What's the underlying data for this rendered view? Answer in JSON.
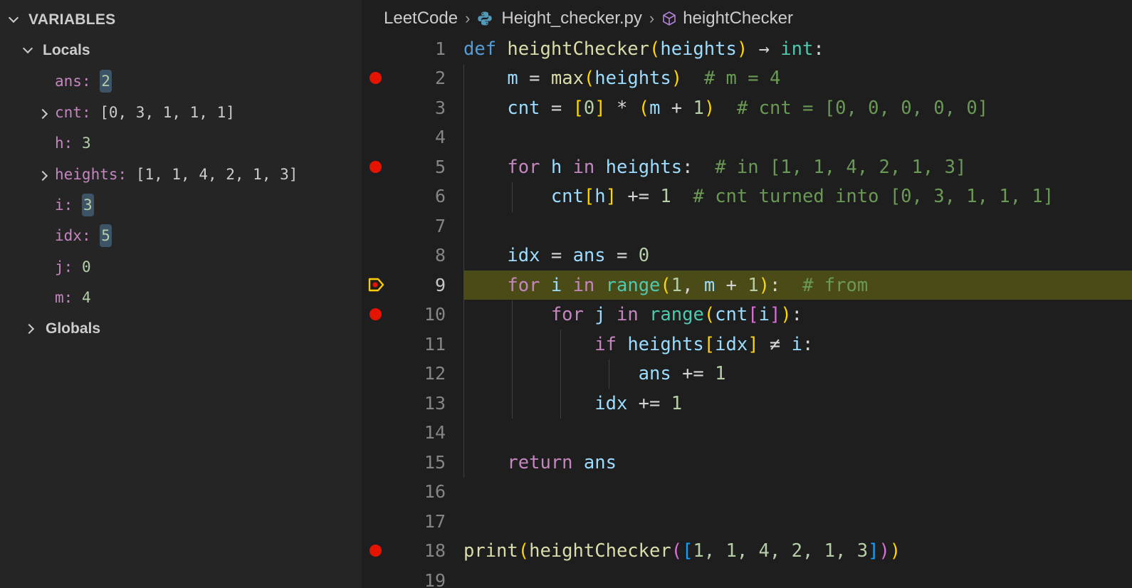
{
  "variables_panel": {
    "title": "VARIABLES",
    "locals_label": "Locals",
    "globals_label": "Globals",
    "locals": [
      {
        "name": "ans",
        "value": "2"
      },
      {
        "name": "cnt",
        "value": "[0, 3, 1, 1, 1]"
      },
      {
        "name": "h",
        "value": "3"
      },
      {
        "name": "heights",
        "value": "[1, 1, 4, 2, 1, 3]"
      },
      {
        "name": "i",
        "value": "3"
      },
      {
        "name": "idx",
        "value": "5"
      },
      {
        "name": "j",
        "value": "0"
      },
      {
        "name": "m",
        "value": "4"
      }
    ]
  },
  "breadcrumb": {
    "folder": "LeetCode",
    "file": "Height_checker.py",
    "symbol": "heightChecker"
  },
  "editor": {
    "line_numbers": [
      "1",
      "2",
      "3",
      "4",
      "5",
      "6",
      "7",
      "8",
      "9",
      "10",
      "11",
      "12",
      "13",
      "14",
      "15",
      "16",
      "17",
      "18",
      "19"
    ],
    "current_line": "9",
    "breakpoint_lines": [
      "2",
      "5",
      "10",
      "18"
    ],
    "lines": {
      "l1": {
        "def": "def",
        "fname": "heightChecker",
        "param": "heights",
        "arrow": "→",
        "rtype": "int"
      },
      "l2": {
        "var": "m",
        "fn": "max",
        "arg": "heights",
        "comment": "# m = 4"
      },
      "l3": {
        "var": "cnt",
        "n0": "0",
        "m": "m",
        "n1": "1",
        "comment": "# cnt = [0, 0, 0, 0, 0]"
      },
      "l5": {
        "for": "for",
        "var": "h",
        "in": "in",
        "iter": "heights",
        "comment": "# in [1, 1, 4, 2, 1, 3]"
      },
      "l6": {
        "var": "cnt",
        "idx": "h",
        "n": "1",
        "comment": "# cnt turned into [0, 3, 1, 1, 1]"
      },
      "l8": {
        "v1": "idx",
        "v2": "ans",
        "n": "0"
      },
      "l9": {
        "for": "for",
        "var": "i",
        "in": "in",
        "fn": "range",
        "n1": "1",
        "m": "m",
        "n2": "1",
        "comment": "# from"
      },
      "l10": {
        "for": "for",
        "var": "j",
        "in": "in",
        "fn": "range",
        "arr": "cnt",
        "idx": "i"
      },
      "l11": {
        "if": "if",
        "arr": "heights",
        "idx": "idx",
        "op": "≠",
        "var": "i"
      },
      "l12": {
        "var": "ans",
        "n": "1"
      },
      "l13": {
        "var": "idx",
        "n": "1"
      },
      "l15": {
        "ret": "return",
        "var": "ans"
      },
      "l18": {
        "fn": "print",
        "call": "heightChecker",
        "list": "1, 1, 4, 2, 1, 3"
      }
    }
  },
  "colors": {
    "current_line_highlight": "#4b4b18",
    "breakpoint": "#e51400",
    "debug_arrow": "#ffcc00"
  }
}
